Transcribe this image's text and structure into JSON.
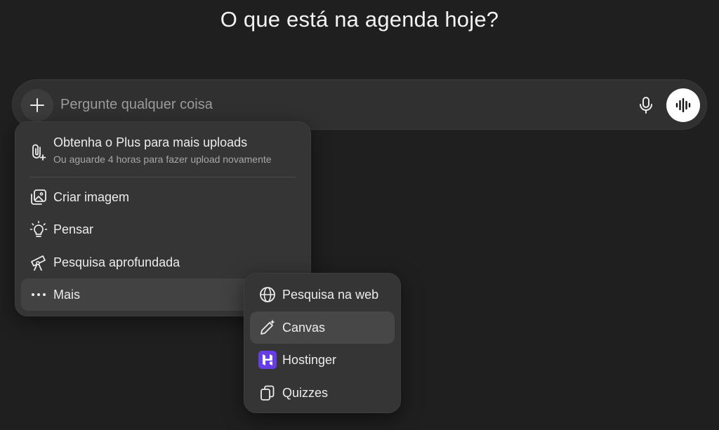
{
  "heading": "O que está na agenda hoje?",
  "composer": {
    "placeholder": "Pergunte qualquer coisa",
    "plus_icon": "plus-icon",
    "mic_icon": "microphone-icon",
    "voice_icon": "voice-waveform-icon"
  },
  "menu": {
    "upload": {
      "label": "Obtenha o Plus para mais uploads",
      "sublabel": "Ou aguarde 4 horas para fazer upload novamente",
      "icon": "paperclip-plus-icon"
    },
    "items": [
      {
        "label": "Criar imagem",
        "icon": "image-icon"
      },
      {
        "label": "Pensar",
        "icon": "lightbulb-icon"
      },
      {
        "label": "Pesquisa aprofundada",
        "icon": "telescope-icon"
      },
      {
        "label": "Mais",
        "icon": "more-dots-icon"
      }
    ]
  },
  "submenu": {
    "items": [
      {
        "label": "Pesquisa na web",
        "icon": "globe-icon"
      },
      {
        "label": "Canvas",
        "icon": "pen-sparkle-icon"
      },
      {
        "label": "Hostinger",
        "icon": "hostinger-logo-icon"
      },
      {
        "label": "Quizzes",
        "icon": "cards-icon"
      }
    ]
  },
  "colors": {
    "background": "#1f1f1f",
    "panel": "#353535",
    "composer": "#303030",
    "hostinger": "#673de6"
  }
}
